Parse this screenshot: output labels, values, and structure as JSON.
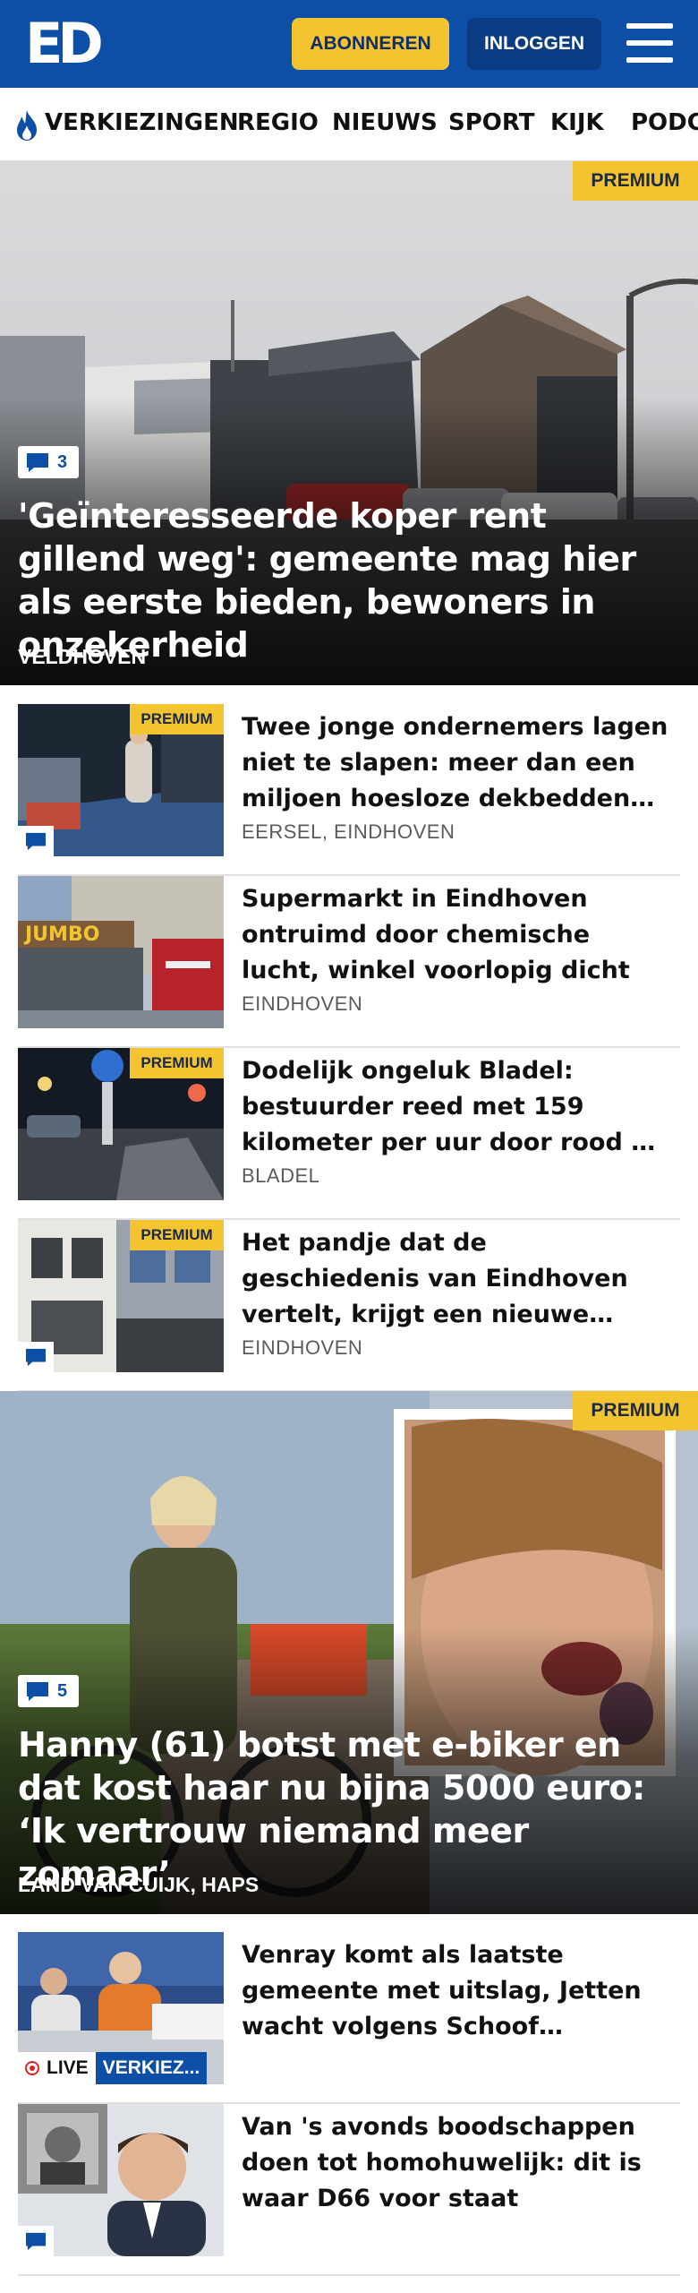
{
  "header": {
    "logo_text": "ED",
    "subscribe_label": "ABONNEREN",
    "login_label": "INLOGGEN",
    "menu_icon": "hamburger-menu-icon"
  },
  "nav": {
    "items": [
      "VERKIEZINGEN",
      "REGIO",
      "NIEUWS",
      "SPORT",
      "KIJK",
      "PODC"
    ],
    "flame_icon": "flame-icon"
  },
  "premium_label": "PREMIUM",
  "hero1": {
    "comments": "3",
    "title": "'Geïnteresseerde koper rent gillend weg': gemeente mag hier als eerste bieden, bewoners in onzekerheid",
    "location": "VELDHOVEN"
  },
  "list1": [
    {
      "title": "Twee jonge ondernemers lagen niet te slapen: meer dan een miljoen hoesloze dekbedden kochten ze op",
      "location": "EERSEL, EINDHOVEN",
      "premium": true,
      "comment": true
    },
    {
      "title": "Supermarkt in Eindhoven ontruimd door chemische lucht, winkel voorlopig dicht",
      "location": "EINDHOVEN",
      "premium": false,
      "comment": false
    },
    {
      "title": "Dodelijk ongeluk Bladel: bestuurder reed met 159 kilometer per uur door rood en botste",
      "location": "BLADEL",
      "premium": true,
      "comment": false
    },
    {
      "title": "Het pandje dat de geschiedenis van Eindhoven vertelt, krijgt een nieuwe toekomst",
      "location": "EINDHOVEN",
      "premium": true,
      "comment": true
    }
  ],
  "hero2": {
    "comments": "5",
    "title": "Hanny (61) botst met e-biker en dat kost haar nu bijna 5000 euro: ‘Ik vertrouw niemand meer zomaar’",
    "location": "LAND VAN CUIJK, HAPS"
  },
  "list2": [
    {
      "title": "Venray komt als laatste gemeente met uitslag, Jetten wacht volgens Schoof ‘ingewikkelde formatie’",
      "live_label": "LIVE",
      "tag_label": "VERKIEZ..."
    },
    {
      "title": "Van 's avonds boodschappen doen tot homohuwelijk: dit is waar D66 voor staat",
      "comment": true
    }
  ],
  "colors": {
    "brand_blue": "#0d4ea6",
    "premium_yellow": "#f4c430",
    "live_red": "#dd2222"
  }
}
